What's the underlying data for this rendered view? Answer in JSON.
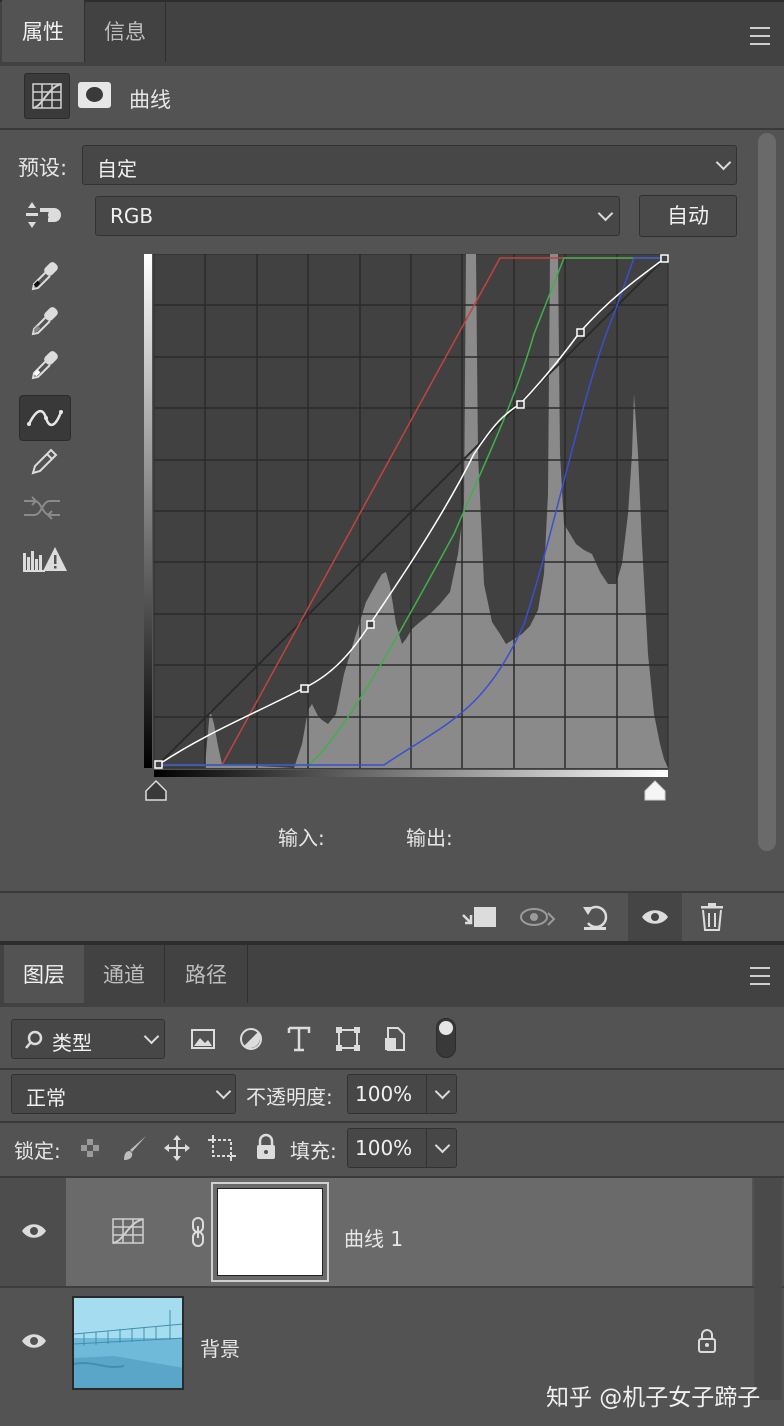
{
  "properties_panel": {
    "tabs": [
      "属性",
      "信息"
    ],
    "adjustment_name": "曲线",
    "preset_label": "预设:",
    "preset_value": "自定",
    "channel_value": "RGB",
    "auto_button": "自动",
    "input_label": "输入:",
    "output_label": "输出:",
    "tools": [
      "eyedropper-black-icon",
      "eyedropper-gray-icon",
      "eyedropper-white-icon",
      "curve-point-icon",
      "pencil-icon",
      "smooth-icon",
      "clipping-warning-icon"
    ],
    "footer_icons": [
      "clip-to-layer-icon",
      "view-previous-icon",
      "reset-icon",
      "visibility-icon",
      "delete-icon"
    ]
  },
  "layers_panel": {
    "tabs": [
      "图层",
      "通道",
      "路径"
    ],
    "filter_label": "类型",
    "blend_mode": "正常",
    "opacity_label": "不透明度:",
    "opacity_value": "100%",
    "lock_label": "锁定:",
    "fill_label": "填充:",
    "fill_value": "100%",
    "layers": [
      {
        "name": "曲线 1",
        "type": "curves",
        "visible": true,
        "selected": true
      },
      {
        "name": "背景",
        "type": "image",
        "visible": true,
        "locked": true
      }
    ]
  },
  "watermark": "知乎 @机子女子蹄子",
  "colors": {
    "panel_bg": "#535353",
    "curve_red": "#c0443f",
    "curve_green": "#3fb04a",
    "curve_blue": "#3a4fd0",
    "curve_white": "#ffffff"
  }
}
